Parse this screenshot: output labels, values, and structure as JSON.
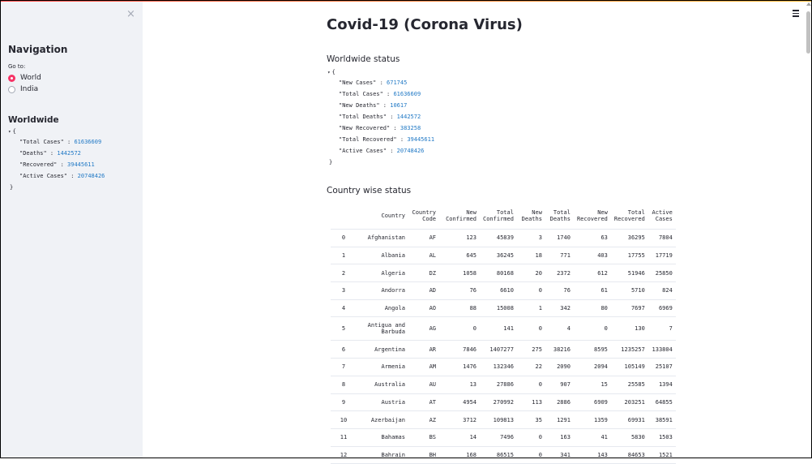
{
  "sidebar": {
    "close": "×",
    "nav_title": "Navigation",
    "goto_label": "Go to:",
    "options": [
      "World",
      "India"
    ],
    "selected": "World",
    "worldwide_title": "Worldwide",
    "json": {
      "open": "{",
      "close": "}",
      "entries": [
        {
          "key": "\"Total Cases\"",
          "value": "61636609"
        },
        {
          "key": "\"Deaths\"",
          "value": "1442572"
        },
        {
          "key": "\"Recovered\"",
          "value": "39445611"
        },
        {
          "key": "\"Active Cases\"",
          "value": "20748426"
        }
      ]
    }
  },
  "main": {
    "title": "Covid-19 (Corona Virus)",
    "worldwide_heading": "Worldwide status",
    "worldwide_json": {
      "open": "{",
      "close": "}",
      "entries": [
        {
          "key": "\"New Cases\"",
          "value": "671745"
        },
        {
          "key": "\"Total Cases\"",
          "value": "61636609"
        },
        {
          "key": "\"New Deaths\"",
          "value": "10617"
        },
        {
          "key": "\"Total Deaths\"",
          "value": "1442572"
        },
        {
          "key": "\"New Recovered\"",
          "value": "383258"
        },
        {
          "key": "\"Total Recovered\"",
          "value": "39445611"
        },
        {
          "key": "\"Active Cases\"",
          "value": "20748426"
        }
      ]
    },
    "country_heading": "Country wise status",
    "table": {
      "columns": [
        "",
        "Country",
        "Country Code",
        "New Confirmed",
        "Total Confirmed",
        "New Deaths",
        "Total Deaths",
        "New Recovered",
        "Total Recovered",
        "Active Cases"
      ],
      "rows": [
        [
          "0",
          "Afghanistan",
          "AF",
          "123",
          "45839",
          "3",
          "1740",
          "63",
          "36295",
          "7804"
        ],
        [
          "1",
          "Albania",
          "AL",
          "645",
          "36245",
          "18",
          "771",
          "403",
          "17755",
          "17719"
        ],
        [
          "2",
          "Algeria",
          "DZ",
          "1058",
          "80168",
          "20",
          "2372",
          "612",
          "51946",
          "25850"
        ],
        [
          "3",
          "Andorra",
          "AD",
          "76",
          "6610",
          "0",
          "76",
          "61",
          "5710",
          "824"
        ],
        [
          "4",
          "Angola",
          "AO",
          "88",
          "15008",
          "1",
          "342",
          "80",
          "7697",
          "6969"
        ],
        [
          "5",
          "Antigua and Barbuda",
          "AG",
          "0",
          "141",
          "0",
          "4",
          "0",
          "130",
          "7"
        ],
        [
          "6",
          "Argentina",
          "AR",
          "7846",
          "1407277",
          "275",
          "38216",
          "8595",
          "1235257",
          "133804"
        ],
        [
          "7",
          "Armenia",
          "AM",
          "1476",
          "132346",
          "22",
          "2090",
          "2094",
          "105149",
          "25107"
        ],
        [
          "8",
          "Australia",
          "AU",
          "13",
          "27886",
          "0",
          "907",
          "15",
          "25585",
          "1394"
        ],
        [
          "9",
          "Austria",
          "AT",
          "4954",
          "270992",
          "113",
          "2886",
          "6909",
          "203251",
          "64855"
        ],
        [
          "10",
          "Azerbaijan",
          "AZ",
          "3712",
          "109813",
          "35",
          "1291",
          "1359",
          "69931",
          "38591"
        ],
        [
          "11",
          "Bahamas",
          "BS",
          "14",
          "7496",
          "0",
          "163",
          "41",
          "5830",
          "1503"
        ],
        [
          "12",
          "Bahrain",
          "BH",
          "168",
          "86515",
          "0",
          "341",
          "143",
          "84653",
          "1521"
        ]
      ]
    }
  }
}
